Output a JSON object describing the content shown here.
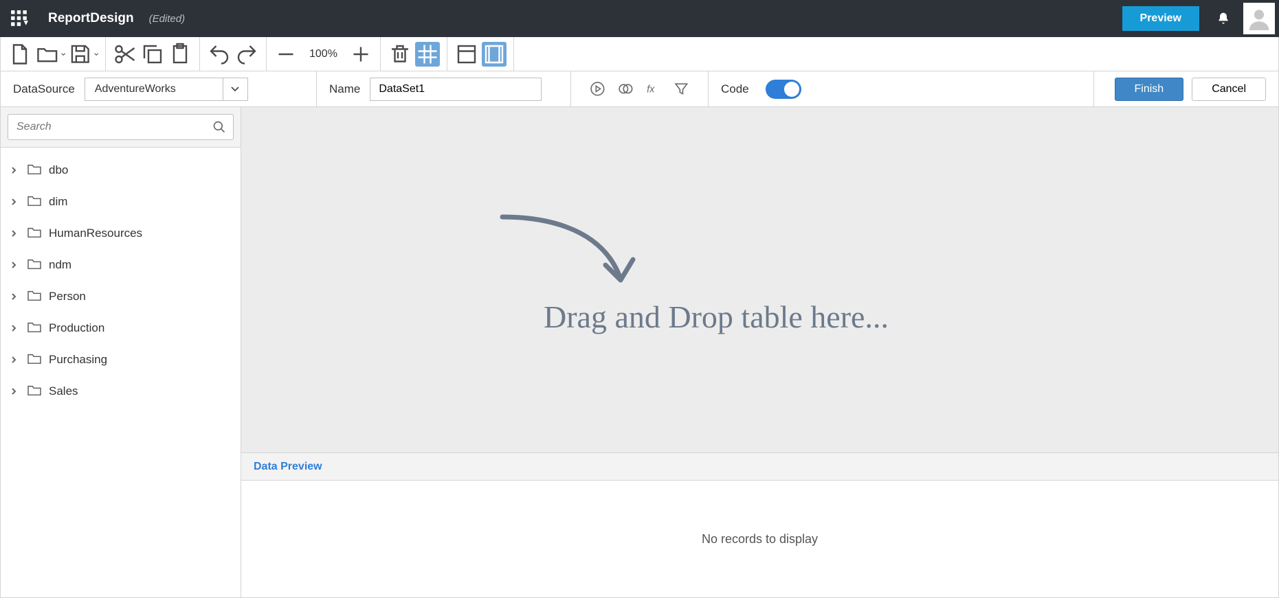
{
  "header": {
    "title": "ReportDesign",
    "edited_label": "(Edited)",
    "preview_label": "Preview"
  },
  "toolbar": {
    "zoom_text": "100%"
  },
  "config": {
    "datasource_label": "DataSource",
    "datasource_value": "AdventureWorks",
    "name_label": "Name",
    "name_value": "DataSet1",
    "code_label": "Code",
    "finish_label": "Finish",
    "cancel_label": "Cancel"
  },
  "sidebar": {
    "search_placeholder": "Search",
    "items": [
      {
        "label": "dbo"
      },
      {
        "label": "dim"
      },
      {
        "label": "HumanResources"
      },
      {
        "label": "ndm"
      },
      {
        "label": "Person"
      },
      {
        "label": "Production"
      },
      {
        "label": "Purchasing"
      },
      {
        "label": "Sales"
      }
    ]
  },
  "canvas": {
    "drag_hint": "Drag and Drop table here..."
  },
  "data_preview": {
    "title": "Data Preview",
    "empty_text": "No records to display"
  }
}
